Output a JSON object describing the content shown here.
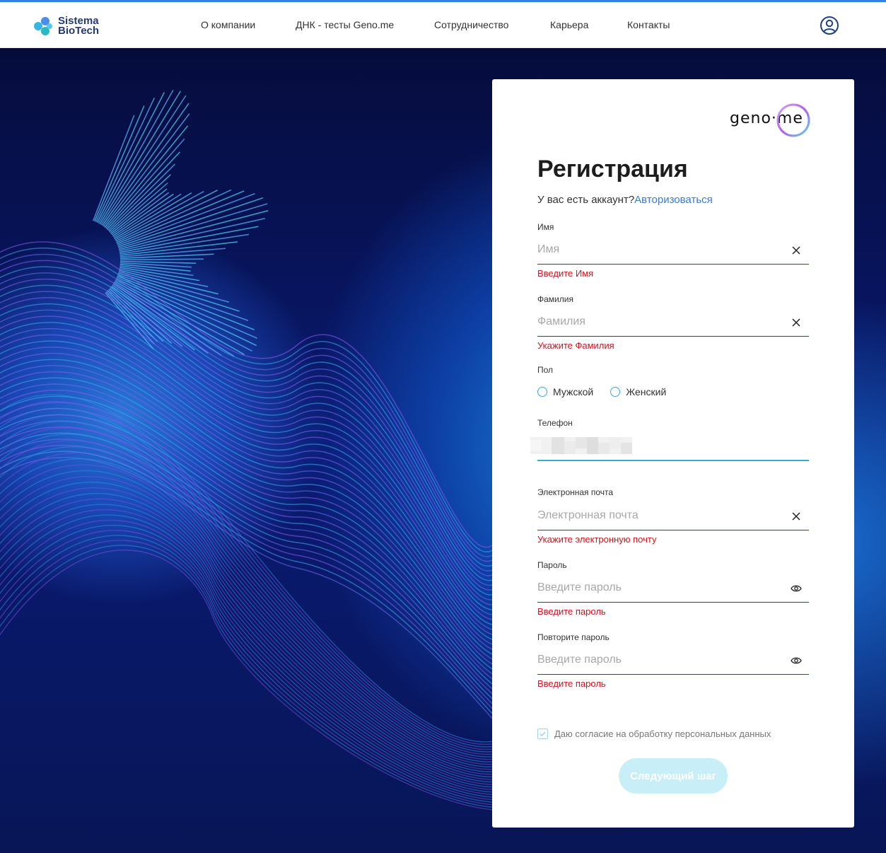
{
  "header": {
    "logo_line1": "Sistema",
    "logo_line2": "BioTech",
    "nav": [
      {
        "label": "О компании"
      },
      {
        "label": "ДНК - тесты Geno.me"
      },
      {
        "label": "Сотрудничество"
      },
      {
        "label": "Карьера"
      },
      {
        "label": "Контакты"
      }
    ],
    "user_icon": "user-circle-icon"
  },
  "colors": {
    "accent": "#3a7bd5",
    "error": "#c8171e",
    "focus": "#39a9d6",
    "button_disabled": "#c8eef8"
  },
  "card": {
    "brand": "geno·me",
    "title": "Регистрация",
    "subtitle_text": "У вас есть аккаунт?",
    "subtitle_link": "Авторизоваться",
    "fields": {
      "first_name": {
        "label": "Имя",
        "placeholder": "Имя",
        "value": "",
        "error": "Введите Имя"
      },
      "last_name": {
        "label": "Фамилия",
        "placeholder": "Фамилия",
        "value": "",
        "error": "Укажите Фамилия"
      },
      "gender": {
        "label": "Пол",
        "options": [
          "Мужской",
          "Женский"
        ]
      },
      "phone": {
        "label": "Телефон"
      },
      "email": {
        "label": "Электронная почта",
        "placeholder": "Электронная почта",
        "value": "",
        "error": "Укажите электронную почту"
      },
      "password": {
        "label": "Пароль",
        "placeholder": "Введите пароль",
        "value": "",
        "error": "Введите пароль"
      },
      "password_repeat": {
        "label": "Повторите пароль",
        "placeholder": "Введите пароль",
        "value": "",
        "error": "Введите пароль"
      }
    },
    "consent": "Даю согласие на обработку персональных данных",
    "next_button": "Следующий шаг"
  }
}
